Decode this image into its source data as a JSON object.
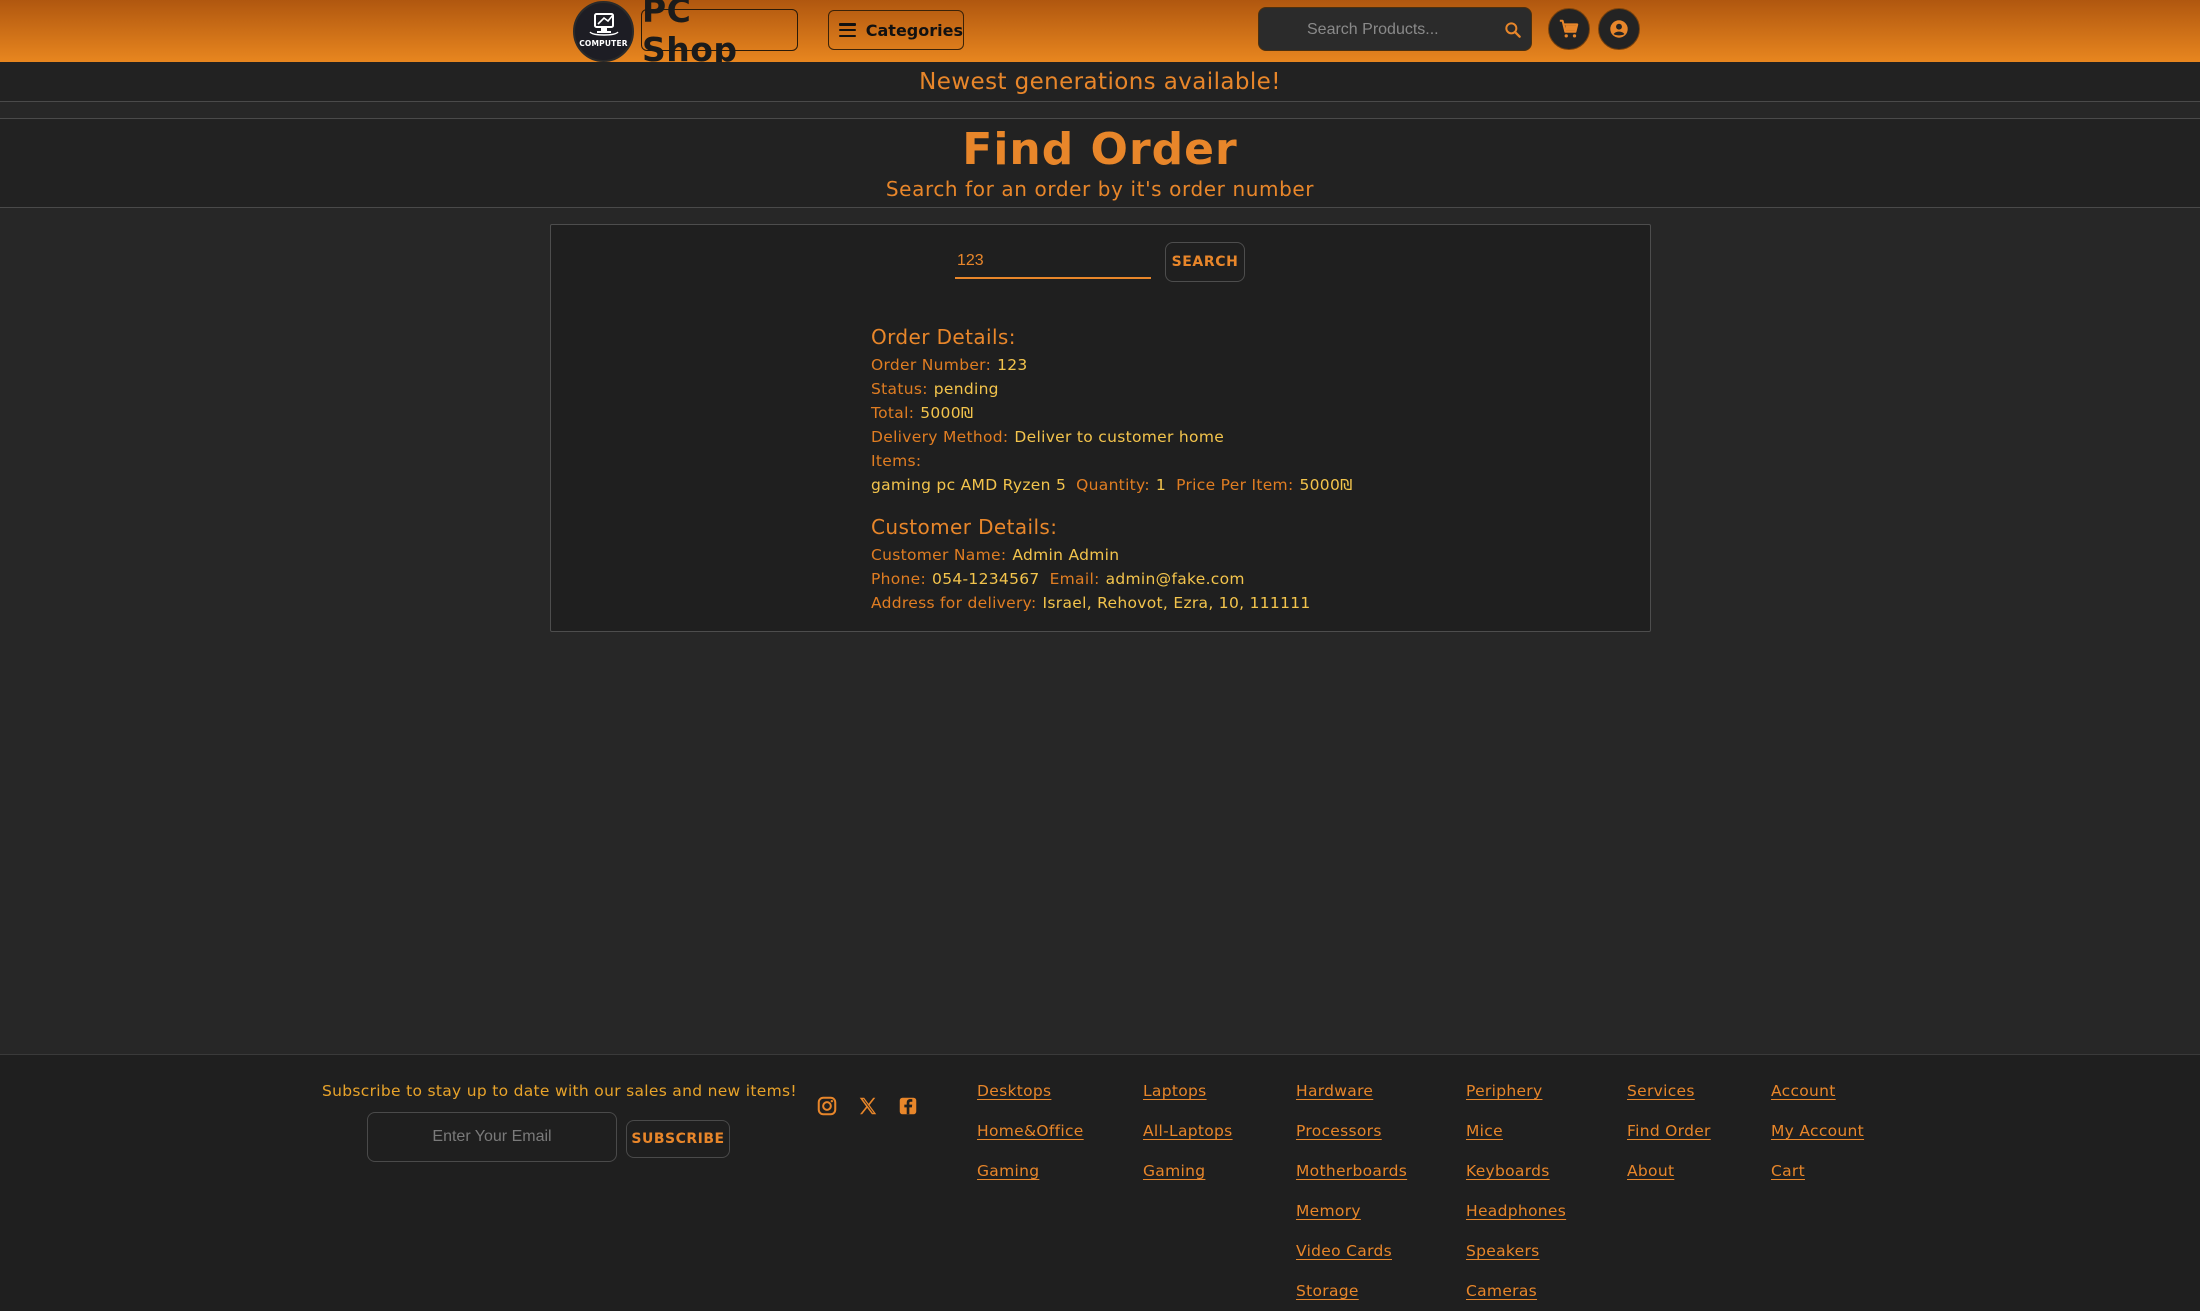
{
  "header": {
    "logo_word": "COMPUTER",
    "brand": "PC Shop",
    "categories_label": "Categories",
    "search_placeholder": "Search Products...",
    "cart_icon": "cart-icon",
    "account_icon": "account-icon"
  },
  "announcement": "Newest generations available!",
  "page": {
    "title": "Find Order",
    "subtitle": "Search for an order by it's order number"
  },
  "search": {
    "value": "123",
    "button_label": "SEARCH"
  },
  "order": {
    "heading": "Order Details:",
    "number_label": "Order Number:",
    "number": "123",
    "status_label": "Status:",
    "status": "pending",
    "total_label": "Total:",
    "total": "5000₪",
    "delivery_label": "Delivery Method:",
    "delivery": "Deliver to customer home",
    "items_label": "Items:",
    "items": [
      {
        "name": "gaming pc AMD Ryzen 5",
        "quantity_label": "Quantity:",
        "quantity": "1",
        "price_label": "Price Per Item:",
        "price": "5000₪"
      }
    ]
  },
  "customer": {
    "heading": "Customer Details:",
    "name_label": "Customer Name:",
    "name": "Admin Admin",
    "phone_label": "Phone:",
    "phone": "054-1234567",
    "email_label": "Email:",
    "email": "admin@fake.com",
    "address_label": "Address for delivery:",
    "address": "Israel, Rehovot, Ezra, 10, 111111"
  },
  "footer": {
    "subscribe_text": "Subscribe to stay up to date with our sales and new items!",
    "email_placeholder": "Enter Your Email",
    "subscribe_label": "SUBSCRIBE",
    "social_icons": [
      "instagram-icon",
      "x-icon",
      "facebook-icon"
    ],
    "columns": [
      {
        "links": [
          "Desktops",
          "Home&Office",
          "Gaming"
        ]
      },
      {
        "links": [
          "Laptops",
          "All-Laptops",
          "Gaming"
        ]
      },
      {
        "links": [
          "Hardware",
          "Processors",
          "Motherboards",
          "Memory",
          "Video Cards",
          "Storage"
        ]
      },
      {
        "links": [
          "Periphery",
          "Mice",
          "Keyboards",
          "Headphones",
          "Speakers",
          "Cameras"
        ]
      },
      {
        "links": [
          "Services",
          "Find Order",
          "About"
        ]
      },
      {
        "links": [
          "Account",
          "My Account",
          "Cart"
        ]
      }
    ]
  },
  "colors": {
    "accent": "#e8862a",
    "value_text": "#f3c44c",
    "background": "#272727",
    "panel": "#1f1f1f",
    "header_gradient_top": "#b0570f",
    "header_gradient_bottom": "#e8861f"
  }
}
